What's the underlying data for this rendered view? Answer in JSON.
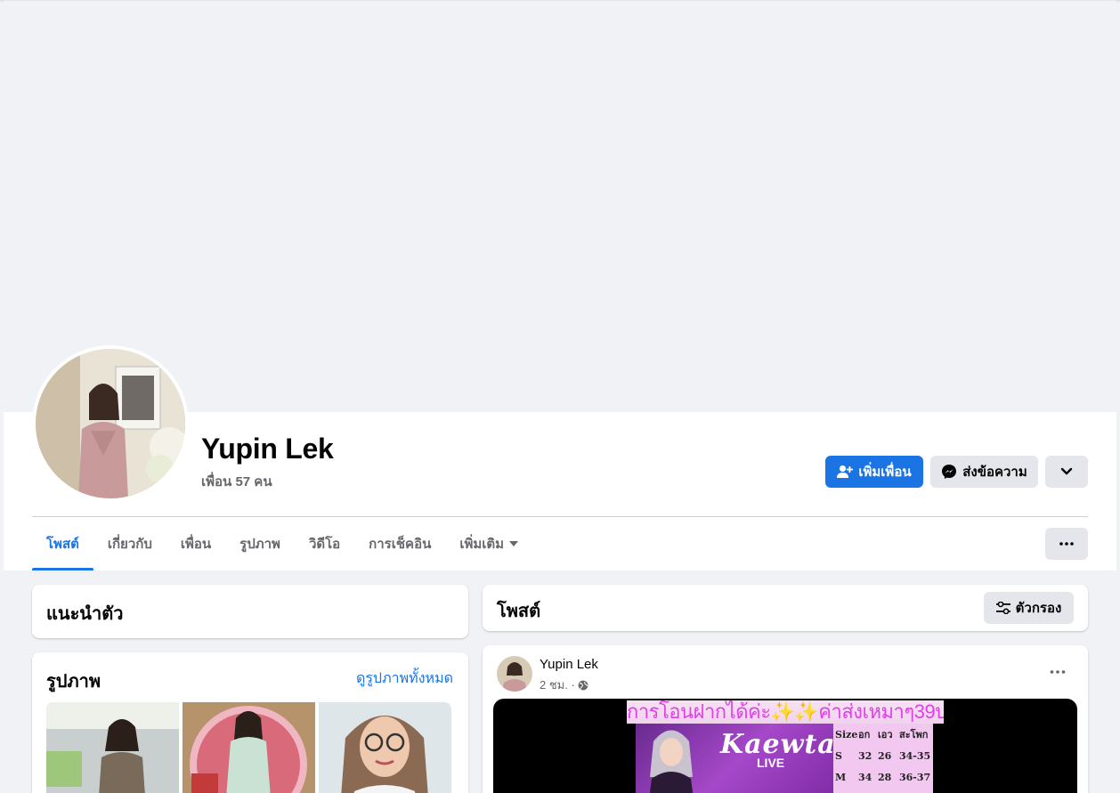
{
  "profile": {
    "name": "Yupin Lek",
    "friends_count": "เพื่อน 57 คน"
  },
  "actions": {
    "add_friend": "เพิ่มเพื่อน",
    "message": "ส่งข้อความ"
  },
  "tabs": [
    {
      "label": "โพสต์",
      "active": true
    },
    {
      "label": "เกี่ยวกับ"
    },
    {
      "label": "เพื่อน"
    },
    {
      "label": "รูปภาพ"
    },
    {
      "label": "วิดีโอ"
    },
    {
      "label": "การเช็คอิน"
    },
    {
      "label": "เพิ่มเติม"
    }
  ],
  "intro": {
    "title": "แนะนำตัว"
  },
  "photos": {
    "title": "รูปภาพ",
    "see_all": "ดูรูปภาพทั้งหมด"
  },
  "posts": {
    "title": "โพสต์",
    "filter_label": "ตัวกรอง"
  },
  "post": {
    "author": "Yupin Lek",
    "time": "2 ชม. ·",
    "banner_text": "การโอนฝากได้ค่ะ✨✨ค่าส่งเหมาๆ39บ",
    "shop_logo": "Kaewta",
    "shop_live": "LIVE",
    "size_table": [
      [
        "Size",
        "อก",
        "เอว",
        "สะโพก"
      ],
      [
        "S",
        "32",
        "26",
        "34-35"
      ],
      [
        "M",
        "34",
        "28",
        "36-37"
      ]
    ]
  },
  "colors": {
    "accent": "#1b74e4",
    "background": "#f0f2f5",
    "secondary_button": "#e4e6eb"
  },
  "icons": {
    "add_friend": "person-plus-icon",
    "message": "messenger-icon",
    "dropdown": "chevron-down-icon",
    "more": "ellipsis-icon",
    "filter": "sliders-icon",
    "privacy": "globe-icon"
  }
}
